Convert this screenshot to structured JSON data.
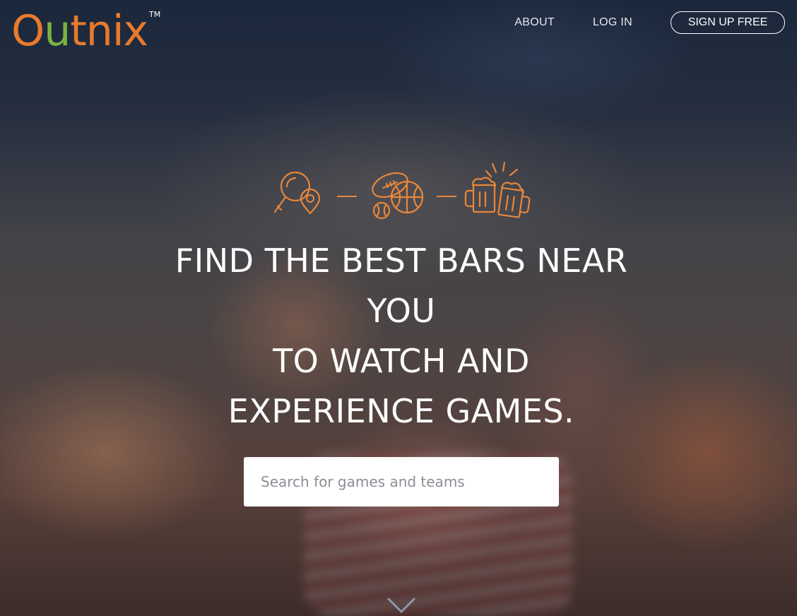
{
  "header": {
    "logo": {
      "o": "O",
      "u": "u",
      "rest": "tnix",
      "tm": "TM"
    },
    "nav": {
      "about": "ABOUT",
      "login": "LOG IN",
      "signup": "SIGN UP FREE"
    }
  },
  "hero": {
    "icons": [
      "search-location-icon",
      "sports-balls-icon",
      "beer-mugs-icon"
    ],
    "accent": "#e8873a",
    "headline": [
      "FIND THE BEST BARS NEAR",
      "YOU",
      "TO WATCH AND",
      "EXPERIENCE GAMES."
    ],
    "search": {
      "placeholder": "Search for games and teams",
      "value": ""
    }
  },
  "colors": {
    "logo_orange": "#e87a2c",
    "logo_green": "#7cb342",
    "text": "#ffffff"
  }
}
